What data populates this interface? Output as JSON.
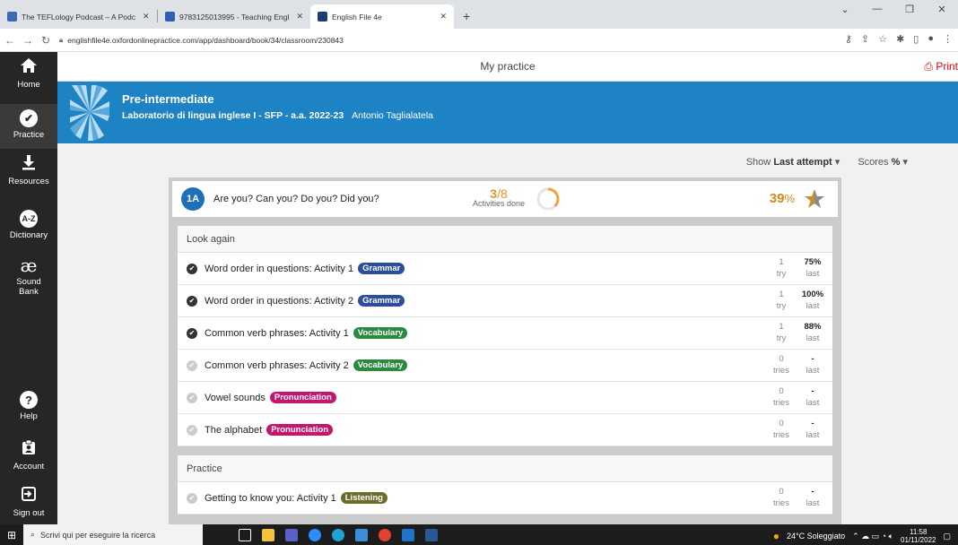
{
  "browser": {
    "tabs": [
      {
        "title": "The TEFLology Podcast – A Podc",
        "color": "#3b6bb8"
      },
      {
        "title": "9783125013995 - Teaching Engli",
        "color": "#2f5fb0"
      },
      {
        "title": "English File 4e",
        "color": "#1a3d73"
      }
    ],
    "new_tab": "+",
    "url": "englishfile4e.oxfordonlinepractice.com/app/dashboard/book/34/classroom/230843"
  },
  "sidebar": {
    "items": [
      {
        "label": "Home"
      },
      {
        "label": "Practice"
      },
      {
        "label": "Resources"
      },
      {
        "label": "Dictionary",
        "glyph": "A-Z"
      },
      {
        "label": "Sound Bank",
        "glyph": "æ"
      },
      {
        "label": "Help"
      },
      {
        "label": "Account"
      },
      {
        "label": "Sign out"
      }
    ]
  },
  "header": {
    "title": "My practice",
    "print_label": "Print"
  },
  "banner": {
    "level": "Pre-intermediate",
    "course": "Laboratorio di lingua inglese I - SFP - a.a. 2022-23",
    "teacher": "Antonio Taglialatela"
  },
  "controls": {
    "show_label": "Show",
    "show_value": "Last attempt",
    "scores_label": "Scores",
    "scores_value": "%"
  },
  "unit": {
    "badge": "1A",
    "title": "Are you? Can you? Do you? Did you?",
    "done": "3",
    "total": "/8",
    "done_label": "Activities done",
    "done_fraction": 0.375,
    "score": "39",
    "score_unit": "%"
  },
  "sections": [
    {
      "title": "Look again",
      "rows": [
        {
          "name": "Word order in questions: Activity 1",
          "tag": "Grammar",
          "tag_type": "grammar",
          "done": true,
          "tries": "1",
          "tries_label": "try",
          "last": "75%",
          "last_label": "last"
        },
        {
          "name": "Word order in questions: Activity 2",
          "tag": "Grammar",
          "tag_type": "grammar",
          "done": true,
          "tries": "1",
          "tries_label": "try",
          "last": "100%",
          "last_label": "last"
        },
        {
          "name": "Common verb phrases: Activity 1",
          "tag": "Vocabulary",
          "tag_type": "vocab",
          "done": true,
          "tries": "1",
          "tries_label": "try",
          "last": "88%",
          "last_label": "last"
        },
        {
          "name": "Common verb phrases: Activity 2",
          "tag": "Vocabulary",
          "tag_type": "vocab",
          "done": false,
          "tries": "0",
          "tries_label": "tries",
          "last": "-",
          "last_label": "last"
        },
        {
          "name": "Vowel sounds",
          "tag": "Pronunciation",
          "tag_type": "pron",
          "done": false,
          "tries": "0",
          "tries_label": "tries",
          "last": "-",
          "last_label": "last"
        },
        {
          "name": "The alphabet",
          "tag": "Pronunciation",
          "tag_type": "pron",
          "done": false,
          "tries": "0",
          "tries_label": "tries",
          "last": "-",
          "last_label": "last"
        }
      ]
    },
    {
      "title": "Practice",
      "rows": [
        {
          "name": "Getting to know you: Activity 1",
          "tag": "Listening",
          "tag_type": "listen",
          "done": false,
          "tries": "0",
          "tries_label": "tries",
          "last": "-",
          "last_label": "last"
        }
      ]
    }
  ],
  "taskbar": {
    "search_placeholder": "Scrivi qui per eseguire la ricerca",
    "weather": "24°C Soleggiato",
    "time": "11:58",
    "date": "01/11/2022"
  }
}
